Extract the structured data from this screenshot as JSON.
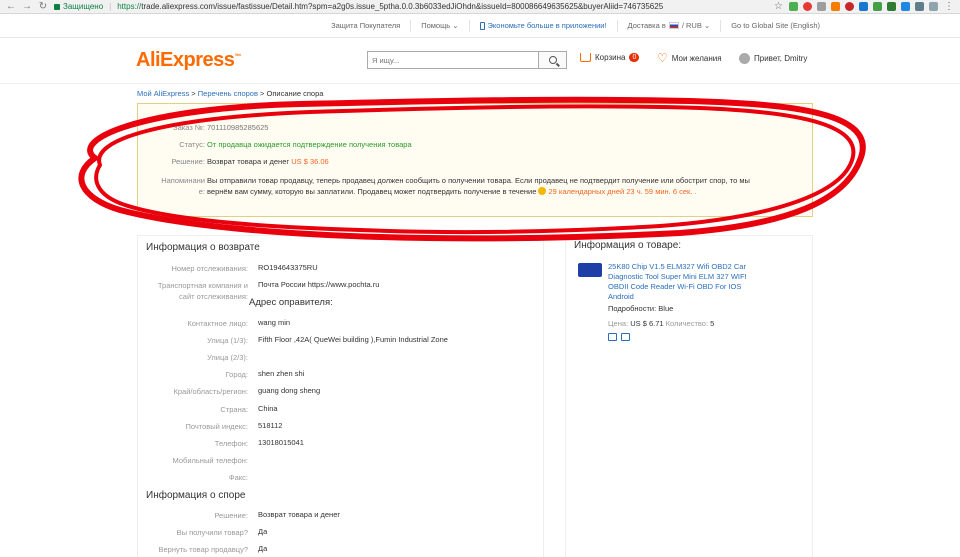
{
  "browser": {
    "secure_label": "Защищено",
    "url_scheme": "https://",
    "url_rest": "trade.aliexpress.com/issue/fastissue/Detail.htm?spm=a2g0s.issue_5ptha.0.0.3b6033edJiOhdn&issueId=800086649635625&buyerAliid=746735625"
  },
  "top_nav": {
    "buyer_protection": "Защита Покупателя",
    "help": "Помощь ⌄",
    "app": "Экономьте больше в приложении!",
    "delivery": "Доставка в",
    "currency": "/ RUB ⌄",
    "global": "Go to Global Site (English)"
  },
  "header": {
    "logo": "AliExpress",
    "search_placeholder": "Я ищу...",
    "cart_label": "Корзина",
    "cart_count": "0",
    "wishlist_label": "Мои желания",
    "greeting": "Привет, Dmitry"
  },
  "breadcrumb": {
    "home": "Мой AliExpress",
    "list": "Перечень споров",
    "sep": " > ",
    "current": "Описание спора"
  },
  "dispute": {
    "order_label": "Заказ №:",
    "order_value": "701110985285625",
    "status_label": "Статус:",
    "status_value": "От продавца ожидается подтверждение получения товара",
    "decision_label": "Решение:",
    "decision_value": "Возврат товара и денег",
    "decision_amount": "US $ 36.06",
    "reminder_label_1": "Напоминани",
    "reminder_label_2": "е:",
    "reminder_line1": "Вы отправили товар продавцу, теперь продавец должен сообщить о получении товара. Если продавец не подтвердит получение или обострит спор, то мы",
    "reminder_line2": "вернём вам сумму, которую вы заплатили. Продавец может подтвердить получение в течение",
    "timer": "29 календарных дней 23 ч. 59 мин. 6 сек. ."
  },
  "return_info": {
    "title": "Информация о возврате",
    "tracking_label": "Номер отслеживания:",
    "tracking_value": "RO194643375RU",
    "carrier_label_1": "Транспортная компания и",
    "carrier_label_2": "сайт отслеживания:",
    "carrier_value": "Почта России https://www.pochta.ru",
    "sender_title": "Адрес оправителя:",
    "contact_label": "Контактное лицо:",
    "contact_value": "wang min",
    "street1_label": "Улица (1/3):",
    "street1_value": "Fifth Floor ,42A( QueWei building ),Fumin Industrial Zone",
    "street2_label": "Улица (2/3):",
    "street2_value": "",
    "city_label": "Город:",
    "city_value": "shen zhen shi",
    "region_label": "Край/область/регион:",
    "region_value": "guang dong sheng",
    "country_label": "Страна:",
    "country_value": "China",
    "zip_label": "Почтовый индекс:",
    "zip_value": "518112",
    "phone_label": "Телефон:",
    "phone_value": "13018015041",
    "mobile_label": "Мобильный телефон:",
    "mobile_value": "",
    "fax_label": "Факс:",
    "fax_value": ""
  },
  "dispute_info": {
    "title": "Информация о споре",
    "decision_label": "Решение:",
    "decision_value": "Возврат товара и денег",
    "received_label": "Вы получили товар?",
    "received_value": "Да",
    "return_label": "Вернуть товар продавцу?",
    "return_value": "Да"
  },
  "product": {
    "title": "Информация о товаре:",
    "name": "25K80 Chip V1.5 ELM327 Wifi OBD2 Car Diagnostic Tool Super Mini ELM 327 WIFI OBDII Code Reader Wi-Fi OBD For IOS Android",
    "details_label": "Подробности:",
    "details_value": "Blue",
    "price_label": "Цена:",
    "price_value": "US $ 6.71",
    "qty_label": "Количество:",
    "qty_value": "5"
  },
  "colors": {
    "brand": "#ff6a00",
    "link": "#2a6ebb",
    "status_green": "#2b9a2b",
    "annotation_red": "#e8000d"
  }
}
